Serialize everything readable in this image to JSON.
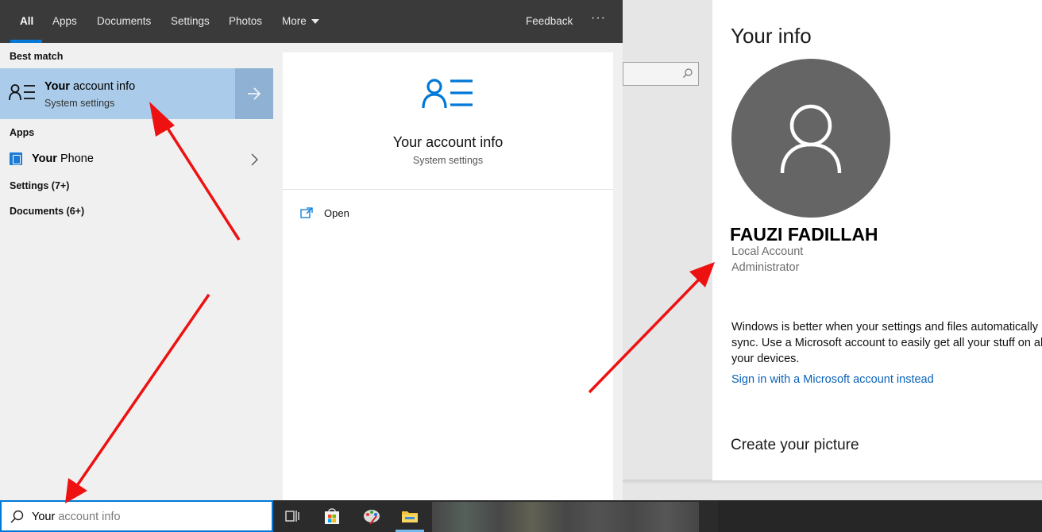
{
  "search_flyout": {
    "tabs": [
      {
        "label": "All",
        "selected": true
      },
      {
        "label": "Apps"
      },
      {
        "label": "Documents"
      },
      {
        "label": "Settings"
      },
      {
        "label": "Photos"
      },
      {
        "label": "More"
      }
    ],
    "feedback_label": "Feedback",
    "more_options_label": "···",
    "best_match": {
      "heading": "Best match",
      "title_bold": "Your",
      "title_rest": " account info",
      "subtitle": "System settings",
      "icon": "account-info-icon"
    },
    "apps": {
      "heading": "Apps",
      "items": [
        {
          "label_bold": "Your",
          "label_rest": " Phone",
          "icon": "your-phone-icon"
        }
      ]
    },
    "settings_group": "Settings (7+)",
    "documents_group": "Documents (6+)",
    "preview": {
      "title": "Your account info",
      "subtitle": "System settings",
      "actions": [
        {
          "label": "Open",
          "icon": "open-icon"
        }
      ]
    }
  },
  "your_info": {
    "title": "Your info",
    "user_name": "FAUZI FADILLAH",
    "account_type": "Local Account",
    "account_role": "Administrator",
    "sync_message": "Windows is better when your settings and files automatically sync. Use a Microsoft account to easily get all your stuff on all your devices.",
    "microsoft_link": "Sign in with a Microsoft account instead",
    "create_picture": "Create your picture"
  },
  "taskbar": {
    "search_typed": "Your",
    "search_rest": " account info",
    "pinned": [
      "task-view-icon",
      "microsoft-store-icon",
      "paint-icon",
      "file-explorer-icon"
    ]
  },
  "colors": {
    "accent": "#0078d7",
    "selection": "#aacbe9",
    "link": "#0a62b8",
    "annotation_arrow": "#ee1111",
    "avatar": "#656565"
  }
}
